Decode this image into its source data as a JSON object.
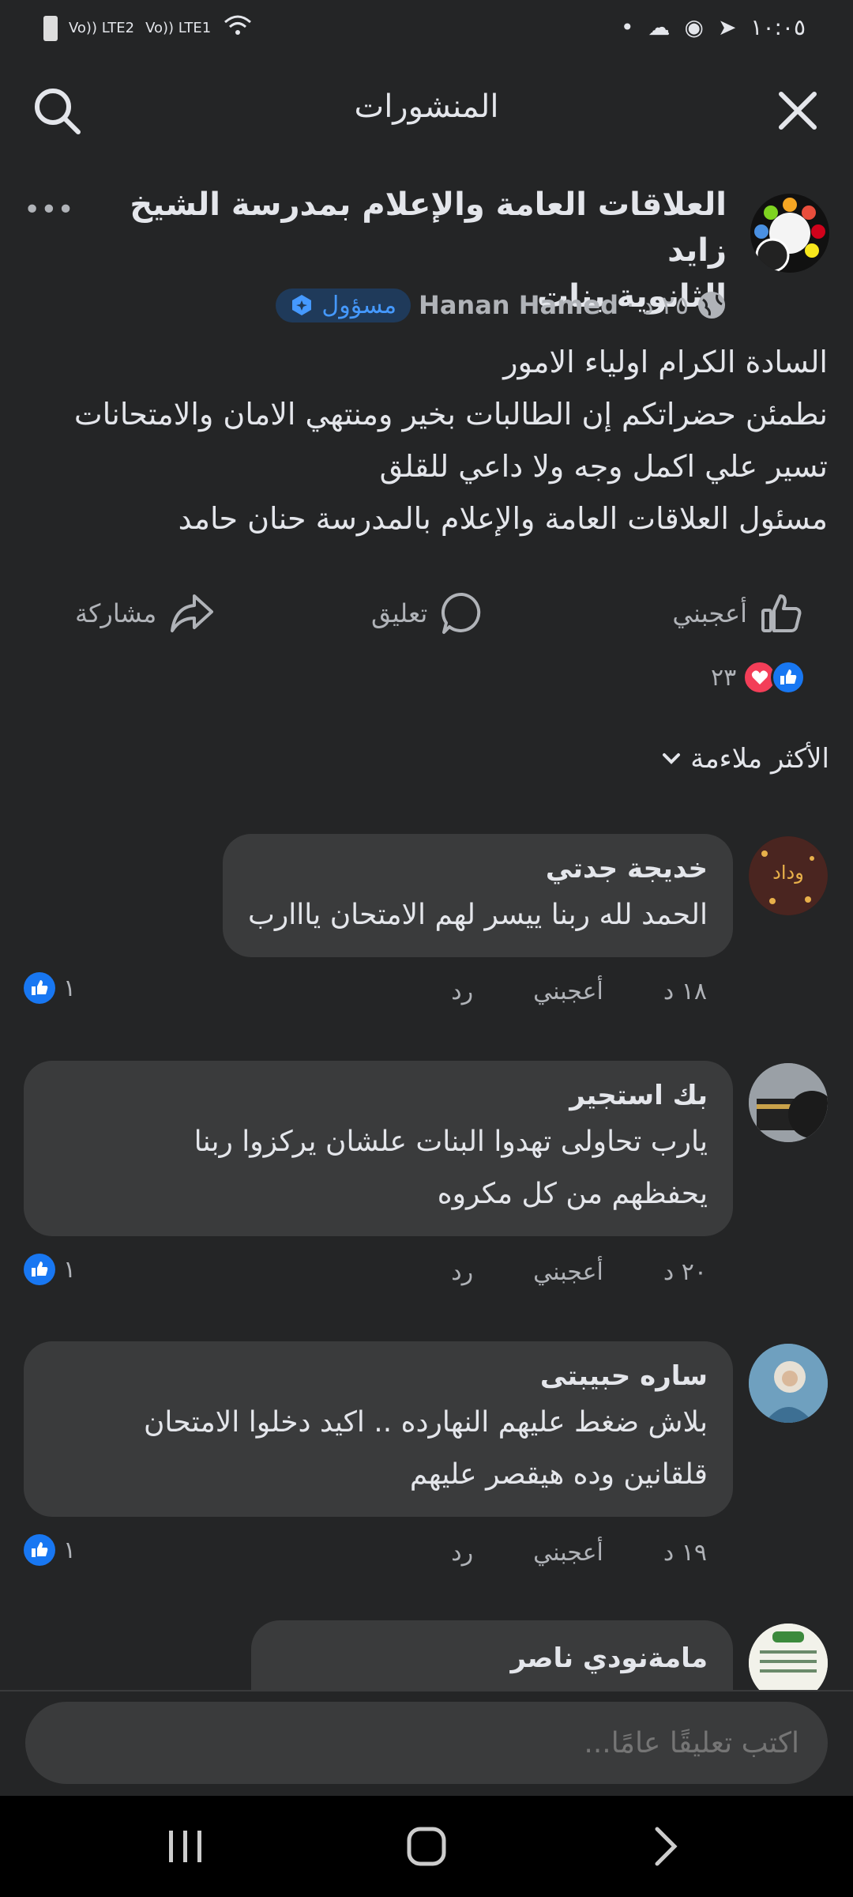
{
  "status": {
    "time": "١٠:٠٥",
    "sim1": "Vo)) LTE2",
    "sim2": "Vo)) LTE1"
  },
  "header": {
    "title": "المنشورات"
  },
  "post": {
    "page_name_line1": "العلاقات العامة والإعلام بمدرسة الشيخ زايد",
    "page_name_line2": "الثانوية بنات",
    "author": "Hanan Hamed",
    "time": "٢٥ د",
    "badge": "مسؤول",
    "body_lines": [
      "السادة الكرام اولياء الامور",
      "نطمئن حضراتكم إن الطالبات بخير ومنتهي الامان والامتحانات",
      "تسير علي اكمل وجه ولا داعي للقلق",
      "مسئول العلاقات العامة والإعلام بالمدرسة حنان حامد"
    ],
    "like_label": "أعجبني",
    "comment_label": "تعليق",
    "share_label": "مشاركة",
    "reaction_count": "٢٣"
  },
  "sort": {
    "label": "الأكثر ملاءمة"
  },
  "comments": [
    {
      "name": "خديجة جدتي",
      "avatar_text": "وداد",
      "lines": [
        "الحمد لله ربنا ييسر لهم الامتحان يااارب"
      ],
      "time": "١٨ د",
      "like": "أعجبني",
      "reply": "رد",
      "likes": "١"
    },
    {
      "name": "بك استجير",
      "lines": [
        "يارب تحاولى تهدوا البنات علشان يركزوا ربنا",
        "يحفظهم من كل مكروه"
      ],
      "time": "٢٠ د",
      "like": "أعجبني",
      "reply": "رد",
      "likes": "١"
    },
    {
      "name": "ساره حبيبتى",
      "lines": [
        "بلاش ضغط عليهم النهارده .. اكيد دخلوا الامتحان",
        "قلقانين وده هيقصر عليهم"
      ],
      "time": "١٩ د",
      "like": "أعجبني",
      "reply": "رد",
      "likes": "١"
    },
    {
      "name": "مامةنودي ناصر"
    }
  ],
  "composer": {
    "placeholder": "اكتب تعليقًا عامًا..."
  },
  "colors": {
    "background": "#242526",
    "bubble": "#3a3b3c",
    "accent": "#1877f2",
    "love": "#f33e58"
  }
}
